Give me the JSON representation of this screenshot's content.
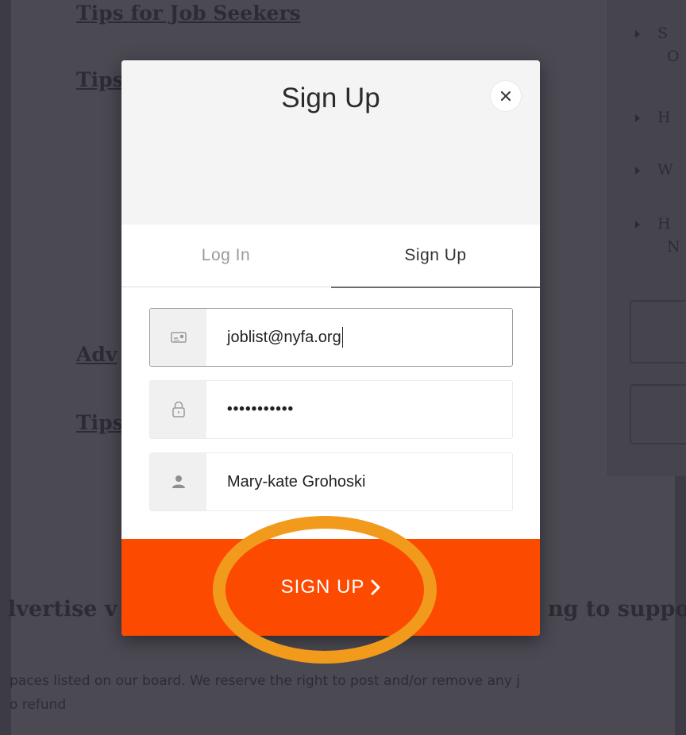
{
  "background": {
    "links": [
      {
        "text": "Tips for Job Seekers"
      },
      {
        "text": "Tips"
      },
      {
        "text": "Adv"
      },
      {
        "text": "Tips"
      }
    ],
    "bullets": [
      {
        "line1": "S",
        "line2": "O"
      },
      {
        "line1": "H",
        "line2": ""
      },
      {
        "line1": "W",
        "line2": ""
      },
      {
        "line1": "H",
        "line2": "N"
      }
    ],
    "heading_left": "lvertise v",
    "heading_right": "ng to suppo",
    "paragraph_line1": "paces listed on our board. We reserve the right to post and/or remove any j",
    "paragraph_line2": "o refund"
  },
  "modal": {
    "title": "Sign Up",
    "close_icon": "close-icon",
    "tabs": [
      {
        "label": "Log In",
        "active": false
      },
      {
        "label": "Sign Up",
        "active": true
      }
    ],
    "fields": {
      "email": {
        "icon": "id-card-icon",
        "value": "joblist@nyfa.org"
      },
      "password": {
        "icon": "lock-icon",
        "value": "•••••••••••"
      },
      "name": {
        "icon": "user-icon",
        "value": "Mary-kate Grohoski"
      }
    },
    "submit_label": "SIGN UP",
    "submit_icon": "chevron-right-icon"
  },
  "colors": {
    "accent": "#fc4a00",
    "highlight": "#f29a1c",
    "overlay": "#3d3c46"
  }
}
